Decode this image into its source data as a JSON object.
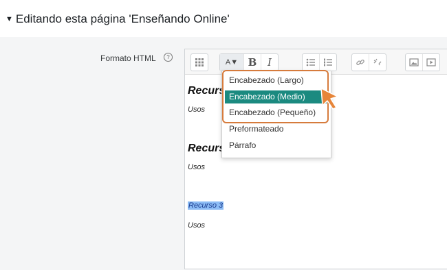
{
  "section": {
    "caret": "▼",
    "title": "Editando esta página 'Enseñando Online'"
  },
  "field": {
    "label": "Formato HTML",
    "help_glyph": "?"
  },
  "toolbar": {
    "buttons": [
      {
        "name": "toolbar-toggle-button",
        "icon": "toolbar-toggle-icon"
      },
      {
        "name": "paragraph-styles-button",
        "icon": "paragraph-style-icon",
        "label": "A▼"
      },
      {
        "name": "bold-button",
        "label": "B"
      },
      {
        "name": "italic-button",
        "label": "I"
      },
      {
        "name": "unordered-list-button",
        "icon": "unordered-list-icon"
      },
      {
        "name": "ordered-list-button",
        "icon": "ordered-list-icon"
      },
      {
        "name": "link-button",
        "icon": "link-icon"
      },
      {
        "name": "unlink-button",
        "icon": "unlink-icon"
      },
      {
        "name": "image-button",
        "icon": "image-icon"
      },
      {
        "name": "media-button",
        "icon": "media-icon"
      }
    ]
  },
  "dropdown": {
    "items": [
      {
        "label": "Encabezado (Largo)"
      },
      {
        "label": "Encabezado (Medio)",
        "active": true
      },
      {
        "label": "Encabezado (Pequeño)"
      },
      {
        "label": "Preformateado"
      },
      {
        "label": "Párrafo"
      }
    ]
  },
  "content": {
    "heading1": "Recurs",
    "body1": "Usos",
    "heading2": "Recurs",
    "body2": "Usos",
    "selected": "Recurso 3",
    "body3": "Usos"
  },
  "colors": {
    "accent": "#1b8a80",
    "highlight": "#d67b3c",
    "selection": "#8cbcf5"
  }
}
